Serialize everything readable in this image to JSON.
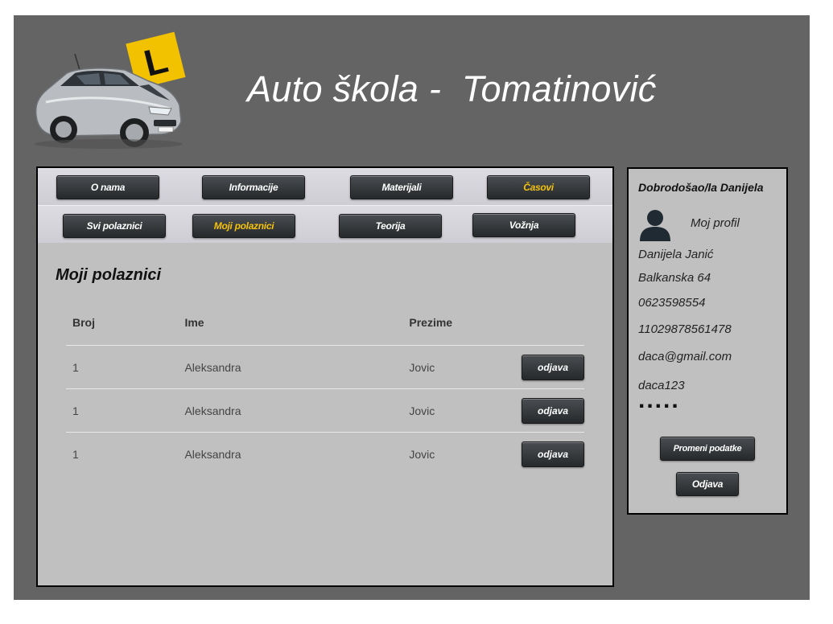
{
  "header": {
    "title": "Auto škola -  Tomatinović",
    "logo_badge": "L"
  },
  "nav": {
    "row1": [
      {
        "label": "O nama",
        "active": false
      },
      {
        "label": "Informacije",
        "active": false
      },
      {
        "label": "Materijali",
        "active": false
      },
      {
        "label": "Časovi",
        "active": true
      }
    ],
    "row2": [
      {
        "label": "Svi polaznici",
        "active": false
      },
      {
        "label": "Moji polaznici",
        "active": true
      },
      {
        "label": "Teorija",
        "active": false
      },
      {
        "label": "Vožnja",
        "active": false
      }
    ]
  },
  "main": {
    "section_title": "Moji polaznici",
    "table": {
      "headers": [
        "Broj",
        "Ime",
        "Prezime"
      ],
      "rows": [
        {
          "broj": "1",
          "ime": "Aleksandra",
          "prezime": "Jovic",
          "action": "odjava"
        },
        {
          "broj": "1",
          "ime": "Aleksandra",
          "prezime": "Jovic",
          "action": "odjava"
        },
        {
          "broj": "1",
          "ime": "Aleksandra",
          "prezime": "Jovic",
          "action": "odjava"
        }
      ]
    }
  },
  "sidebar": {
    "welcome": "Dobrodošao/la Danijela",
    "profile_link": "Moj profil",
    "full_name": "Danijela Janić",
    "address": "Balkanska 64",
    "phone": "0623598554",
    "jmbg": "11029878561478",
    "email": "daca@gmail.com",
    "username": "daca123",
    "password_mask": ".....",
    "change_button": "Promeni podatke",
    "logout_button": "Odjava"
  },
  "colors": {
    "frame_bg": "#646464",
    "panel_bg": "#c0c0c0",
    "active_nav": "#f4c20d",
    "button_bg": "#2e3133"
  }
}
